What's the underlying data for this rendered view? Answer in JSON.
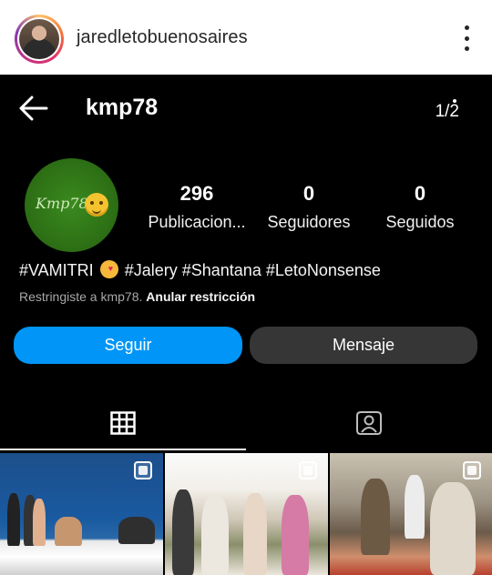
{
  "post_header": {
    "username": "jaredletobuenosaires",
    "more_icon": "more-vertical-icon"
  },
  "screenshot": {
    "topbar": {
      "back_icon": "arrow-left-icon",
      "username": "kmp78",
      "counter": "1/2"
    },
    "profile": {
      "avatar_text": "Kmp78",
      "stats": [
        {
          "value": "296",
          "label": "Publicacion..."
        },
        {
          "value": "0",
          "label": "Seguidores"
        },
        {
          "value": "0",
          "label": "Seguidos"
        }
      ],
      "bio_part1": "#VAMITRI",
      "bio_part2": "#Jalery #Shantana #LetoNonsense",
      "restrict_text": "Restringiste a kmp78.",
      "restrict_link": "Anular restricción"
    },
    "buttons": {
      "follow": "Seguir",
      "message": "Mensaje"
    },
    "tabs": [
      {
        "icon": "grid-icon",
        "active": true
      },
      {
        "icon": "tagged-person-icon",
        "active": false
      }
    ],
    "thumbnails": [
      {
        "icon": "multiple-posts-icon"
      },
      {
        "icon": "multiple-posts-icon"
      },
      {
        "icon": "multiple-posts-icon"
      }
    ],
    "colors": {
      "follow_button": "#0095f6",
      "message_button": "#363636",
      "background": "#000000"
    }
  }
}
